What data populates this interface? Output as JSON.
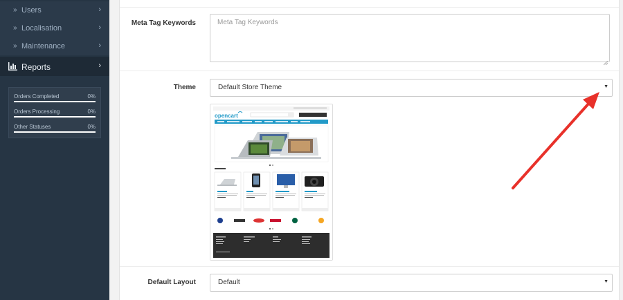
{
  "sidebar": {
    "sub_items": [
      {
        "label": "Users"
      },
      {
        "label": "Localisation"
      },
      {
        "label": "Maintenance"
      }
    ],
    "active_item": {
      "label": "Reports"
    },
    "stats": [
      {
        "label": "Orders Completed",
        "percent": "0%"
      },
      {
        "label": "Orders Processing",
        "percent": "0%"
      },
      {
        "label": "Other Statuses",
        "percent": "0%"
      }
    ]
  },
  "form": {
    "meta_keywords": {
      "label": "Meta Tag Keywords",
      "placeholder": "Meta Tag Keywords",
      "value": ""
    },
    "theme": {
      "label": "Theme",
      "selected": "Default Store Theme"
    },
    "default_layout": {
      "label": "Default Layout",
      "selected": "Default"
    }
  },
  "theme_preview": {
    "logo_text": "opencart"
  },
  "colors": {
    "sidebar_bg": "#263544",
    "accent_blue": "#229ac8",
    "annotation_arrow": "#e8312a"
  }
}
